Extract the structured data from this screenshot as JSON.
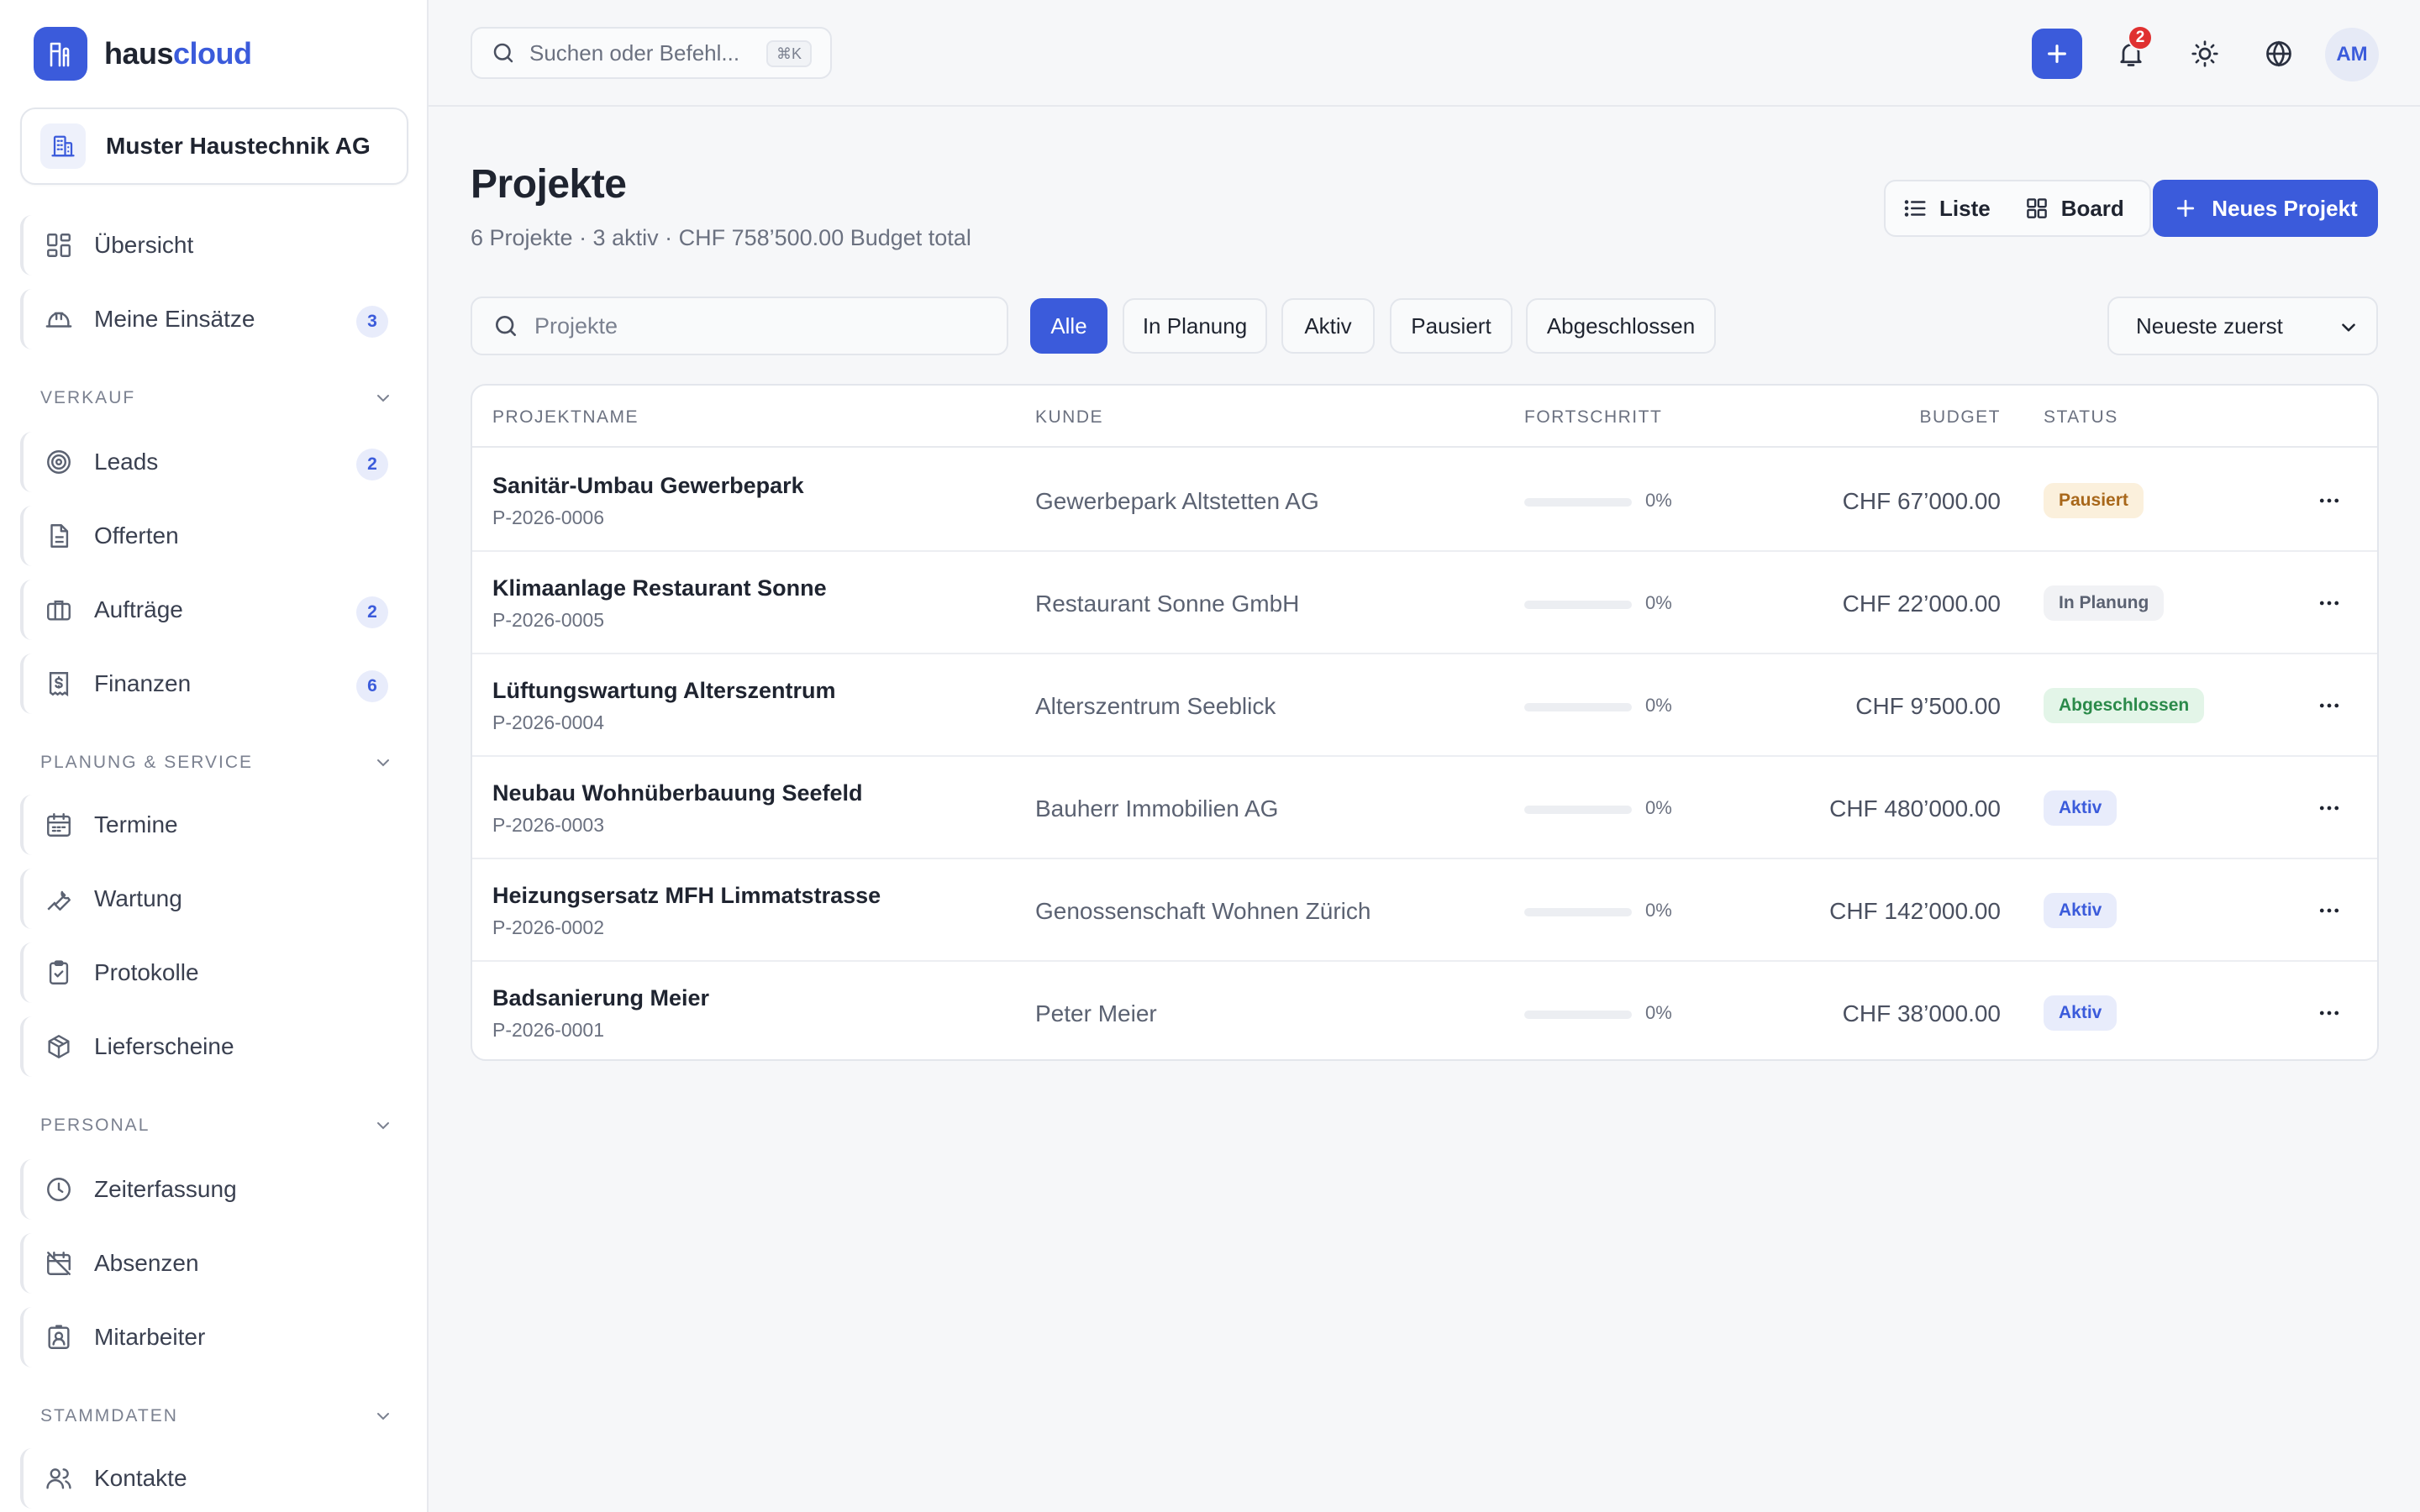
{
  "brand": {
    "name_part1": "haus",
    "name_part2": "cloud"
  },
  "company": {
    "name": "Muster Haustechnik AG"
  },
  "sidebar": {
    "top_items": [
      {
        "label": "Übersicht",
        "icon": "dashboard-icon"
      },
      {
        "label": "Meine Einsätze",
        "icon": "hardhat-icon",
        "count": "3"
      }
    ],
    "sections": [
      {
        "title": "Verkauf",
        "items": [
          {
            "label": "Leads",
            "icon": "target-icon",
            "count": "2"
          },
          {
            "label": "Offerten",
            "icon": "document-icon"
          },
          {
            "label": "Aufträge",
            "icon": "briefcase-icon",
            "count": "2"
          },
          {
            "label": "Finanzen",
            "icon": "invoice-dollar-icon",
            "count": "6"
          }
        ]
      },
      {
        "title": "Planung & Service",
        "items": [
          {
            "label": "Termine",
            "icon": "calendar-icon"
          },
          {
            "label": "Wartung",
            "icon": "wrench-icon"
          },
          {
            "label": "Protokolle",
            "icon": "clipboard-check-icon"
          },
          {
            "label": "Lieferscheine",
            "icon": "package-icon"
          }
        ]
      },
      {
        "title": "Personal",
        "items": [
          {
            "label": "Zeiterfassung",
            "icon": "clock-icon"
          },
          {
            "label": "Absenzen",
            "icon": "calendar-off-icon"
          },
          {
            "label": "Mitarbeiter",
            "icon": "id-badge-icon"
          }
        ]
      },
      {
        "title": "Stammdaten",
        "items": [
          {
            "label": "Kontakte",
            "icon": "users-icon"
          }
        ]
      }
    ]
  },
  "topbar": {
    "search_placeholder": "Suchen oder Befehl...",
    "shortcut": "⌘K",
    "notification_count": "2",
    "avatar_initials": "AM"
  },
  "page": {
    "title": "Projekte",
    "subtitle": "6 Projekte · 3 aktiv · CHF 758’500.00 Budget total",
    "view_list_label": "Liste",
    "view_board_label": "Board",
    "new_button_label": "Neues Projekt",
    "search_placeholder": "Projekte",
    "filters": [
      "Alle",
      "In Planung",
      "Aktiv",
      "Pausiert",
      "Abgeschlossen"
    ],
    "active_filter": "Alle",
    "sort_selected": "Neueste zuerst"
  },
  "table": {
    "columns": {
      "name": "Projektname",
      "client": "Kunde",
      "progress": "Fortschritt",
      "budget": "Budget",
      "status": "Status"
    },
    "rows": [
      {
        "name": "Sanitär-Umbau Gewerbepark",
        "id": "P-2026-0006",
        "client": "Gewerbepark Altstetten AG",
        "progress": 0,
        "progress_label": "0%",
        "budget": "CHF 67’000.00",
        "status": "Pausiert",
        "status_type": "paused"
      },
      {
        "name": "Klimaanlage Restaurant Sonne",
        "id": "P-2026-0005",
        "client": "Restaurant Sonne GmbH",
        "progress": 0,
        "progress_label": "0%",
        "budget": "CHF 22’000.00",
        "status": "In Planung",
        "status_type": "planning"
      },
      {
        "name": "Lüftungswartung Alterszentrum",
        "id": "P-2026-0004",
        "client": "Alterszentrum Seeblick",
        "progress": 0,
        "progress_label": "0%",
        "budget": "CHF 9’500.00",
        "status": "Abgeschlossen",
        "status_type": "done"
      },
      {
        "name": "Neubau Wohnüberbauung Seefeld",
        "id": "P-2026-0003",
        "client": "Bauherr Immobilien AG",
        "progress": 0,
        "progress_label": "0%",
        "budget": "CHF 480’000.00",
        "status": "Aktiv",
        "status_type": "active"
      },
      {
        "name": "Heizungsersatz MFH Limmatstrasse",
        "id": "P-2026-0002",
        "client": "Genossenschaft Wohnen Zürich",
        "progress": 0,
        "progress_label": "0%",
        "budget": "CHF 142’000.00",
        "status": "Aktiv",
        "status_type": "active"
      },
      {
        "name": "Badsanierung Meier",
        "id": "P-2026-0001",
        "client": "Peter Meier",
        "progress": 0,
        "progress_label": "0%",
        "budget": "CHF 38’000.00",
        "status": "Aktiv",
        "status_type": "active"
      }
    ]
  },
  "colors": {
    "accent": "#3b5bdb",
    "status_paused_bg": "#fbf0dc",
    "status_paused_fg": "#a8671a",
    "status_planning_bg": "#f1f2f5",
    "status_planning_fg": "#5b6272",
    "status_done_bg": "#e3f5e8",
    "status_done_fg": "#2b8a4a",
    "status_active_bg": "#e8ecfb",
    "status_active_fg": "#3b5bdb"
  }
}
